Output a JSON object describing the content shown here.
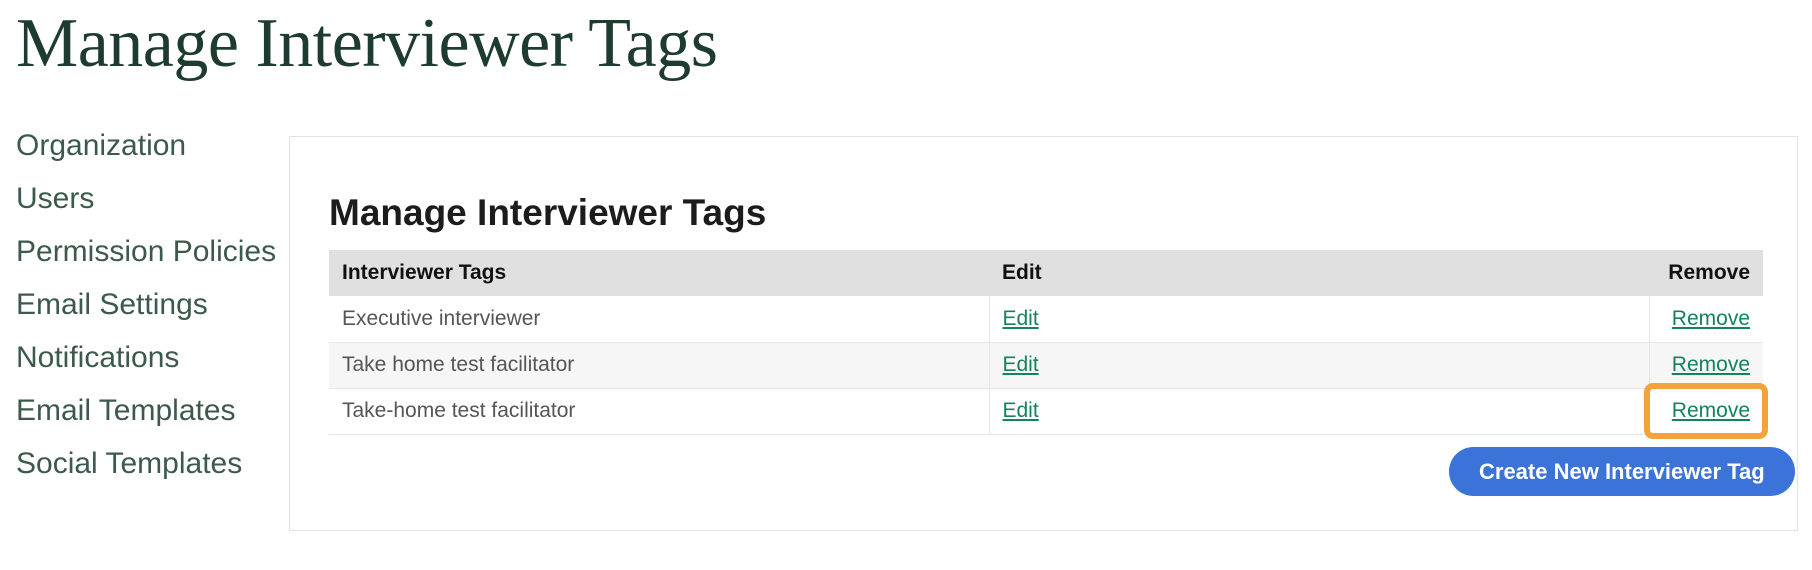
{
  "page": {
    "title": "Manage Interviewer Tags"
  },
  "sidebar": {
    "items": [
      {
        "label": "Organization"
      },
      {
        "label": "Users"
      },
      {
        "label": "Permission Policies"
      },
      {
        "label": "Email Settings"
      },
      {
        "label": "Notifications"
      },
      {
        "label": "Email Templates"
      },
      {
        "label": "Social Templates"
      }
    ]
  },
  "card": {
    "title": "Manage Interviewer Tags",
    "table": {
      "headers": {
        "tag": "Interviewer Tags",
        "edit": "Edit",
        "remove": "Remove"
      },
      "rows": [
        {
          "tag": "Executive interviewer",
          "edit": "Edit",
          "remove": "Remove",
          "highlighted": false
        },
        {
          "tag": "Take home test facilitator",
          "edit": "Edit",
          "remove": "Remove",
          "highlighted": false
        },
        {
          "tag": "Take-home test facilitator",
          "edit": "Edit",
          "remove": "Remove",
          "highlighted": true
        }
      ]
    },
    "create_button": "Create New Interviewer Tag"
  },
  "colors": {
    "title_green": "#1d3b2f",
    "sidebar_green": "#3c5a4b",
    "link_green": "#14835a",
    "button_blue": "#3b73d8",
    "highlight_orange": "#f2a33c",
    "header_row_gray": "#e0e0e0",
    "alt_row_gray": "#f6f6f6"
  }
}
